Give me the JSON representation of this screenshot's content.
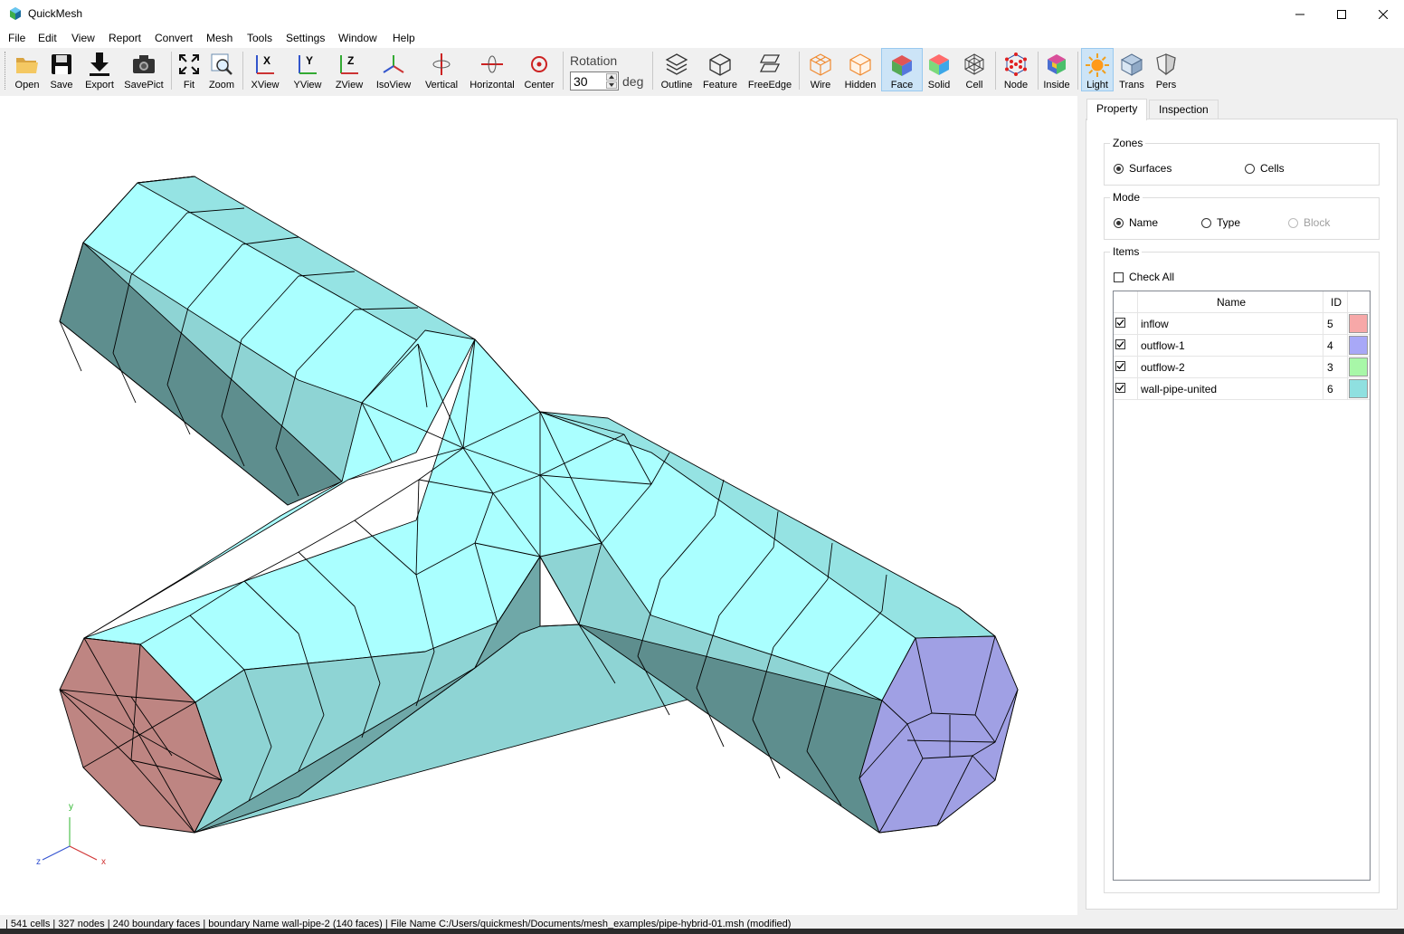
{
  "window": {
    "title": "QuickMesh",
    "controls": [
      "minimize",
      "maximize",
      "close"
    ]
  },
  "menu": [
    "File",
    "Edit",
    "View",
    "Report",
    "Convert",
    "Mesh",
    "Tools",
    "Settings",
    "Window",
    "Help"
  ],
  "toolbar": {
    "buttons": [
      {
        "label": "Open",
        "icon": "folder-open-icon"
      },
      {
        "label": "Save",
        "icon": "floppy-disk-icon"
      },
      {
        "label": "Export",
        "icon": "download-arrow-icon"
      },
      {
        "label": "SavePict",
        "icon": "camera-icon"
      },
      {
        "label": "Fit",
        "icon": "fit-expand-icon"
      },
      {
        "label": "Zoom",
        "icon": "zoom-magnifier-icon"
      },
      {
        "label": "XView",
        "icon": "x-view-axes-icon"
      },
      {
        "label": "YView",
        "icon": "y-view-axes-icon"
      },
      {
        "label": "ZView",
        "icon": "z-view-axes-icon"
      },
      {
        "label": "IsoView",
        "icon": "iso-view-axes-icon"
      },
      {
        "label": "Vertical",
        "icon": "vertical-rotate-icon"
      },
      {
        "label": "Horizontal",
        "icon": "horizontal-rotate-icon"
      },
      {
        "label": "Center",
        "icon": "center-target-icon"
      },
      {
        "label": "Outline",
        "icon": "outline-layers-icon"
      },
      {
        "label": "Feature",
        "icon": "feature-cube-icon"
      },
      {
        "label": "FreeEdge",
        "icon": "free-edge-icon"
      },
      {
        "label": "Wire",
        "icon": "wire-cube-icon"
      },
      {
        "label": "Hidden",
        "icon": "hidden-cube-icon"
      },
      {
        "label": "Face",
        "icon": "face-cube-icon"
      },
      {
        "label": "Solid",
        "icon": "solid-cube-icon"
      },
      {
        "label": "Cell",
        "icon": "cell-sphere-icon"
      },
      {
        "label": "Node",
        "icon": "node-sphere-icon"
      },
      {
        "label": "Inside",
        "icon": "inside-hexagon-icon"
      },
      {
        "label": "Light",
        "icon": "sun-light-icon"
      },
      {
        "label": "Trans",
        "icon": "transparent-cube-icon"
      },
      {
        "label": "Pers",
        "icon": "perspective-shield-icon"
      }
    ],
    "rotation": {
      "label": "Rotation",
      "value": "30",
      "unit": "deg"
    }
  },
  "axes": {
    "y": "y",
    "x": "x",
    "z": "z"
  },
  "mesh_colors": {
    "inflow": "#be8582",
    "outflow": "#a0a0e4",
    "wall_light": "#aaffff",
    "wall_mid": "#8ed4d4",
    "wall_dark": "#5e8e8e"
  },
  "panel": {
    "tabs": [
      "Property",
      "Inspection"
    ],
    "zones": {
      "title": "Zones",
      "options": [
        "Surfaces",
        "Cells"
      ],
      "selected": "Surfaces"
    },
    "mode": {
      "title": "Mode",
      "options": [
        "Name",
        "Type",
        "Block"
      ],
      "selected": "Name",
      "disabled": "Block"
    },
    "items": {
      "title": "Items",
      "check_all": "Check All",
      "columns": {
        "name": "Name",
        "id": "ID"
      },
      "rows": [
        {
          "name": "inflow",
          "id": "5",
          "color": "#f7a8a8",
          "checked": true
        },
        {
          "name": "outflow-1",
          "id": "4",
          "color": "#a8a8f7",
          "checked": true
        },
        {
          "name": "outflow-2",
          "id": "3",
          "color": "#a8f7a8",
          "checked": true
        },
        {
          "name": "wall-pipe-united",
          "id": "6",
          "color": "#8fe0e0",
          "checked": true
        }
      ]
    }
  },
  "status": "| 541 cells | 327 nodes | 240 boundary faces |  boundary Name wall-pipe-2 (140 faces) | File Name C:/Users/quickmesh/Documents/mesh_examples/pipe-hybrid-01.msh (modified)"
}
